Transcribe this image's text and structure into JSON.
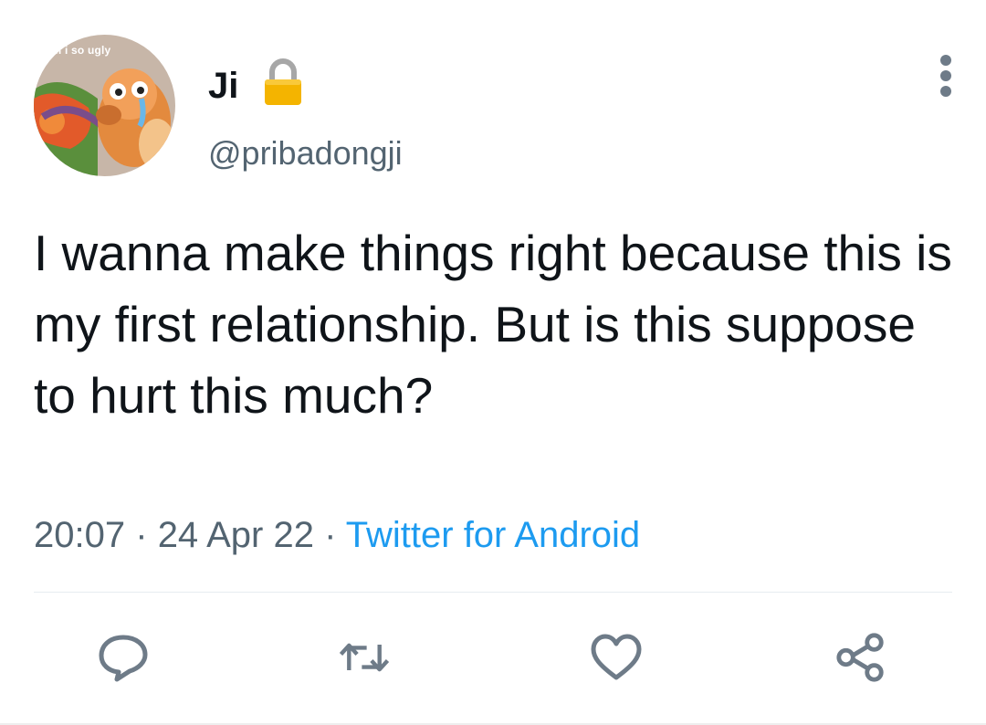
{
  "tweet": {
    "avatar": {
      "caption": "im i so ugly"
    },
    "user": {
      "display_name": "Ji",
      "handle": "@pribadongji",
      "lock_icon": "lock-icon"
    },
    "text": "I wanna make things right because this is my first relationship. But is this suppose to hurt this much?",
    "time": "20:07",
    "separator": "·",
    "date": "24 Apr 22",
    "source": "Twitter for Android",
    "actions": [
      {
        "name": "reply",
        "icon": "reply-icon"
      },
      {
        "name": "retweet",
        "icon": "retweet-icon"
      },
      {
        "name": "like",
        "icon": "heart-icon"
      },
      {
        "name": "share",
        "icon": "share-icon"
      }
    ]
  },
  "colors": {
    "text_primary": "#0f1419",
    "text_secondary": "#536471",
    "link": "#1d9bf0",
    "lock": "#f4b400",
    "icon_gray": "#6e7b88"
  }
}
